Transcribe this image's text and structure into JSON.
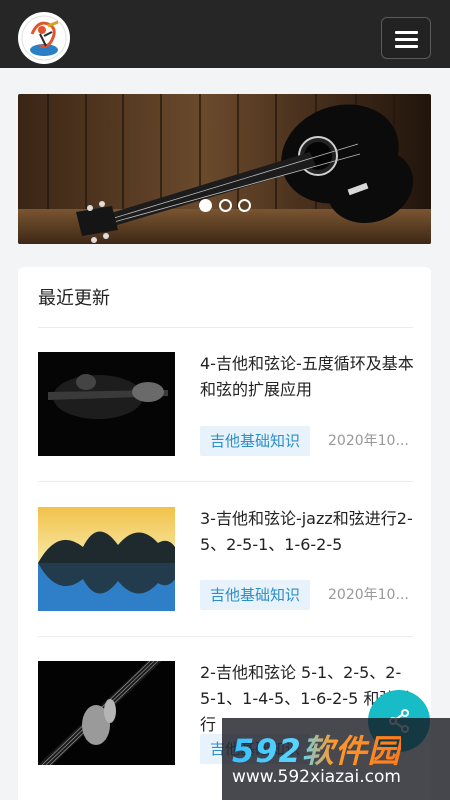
{
  "header": {
    "logo_icon": "guitar-logo-icon",
    "menu_icon": "hamburger-menu-icon"
  },
  "banner": {
    "slide_count": 3,
    "active_slide": 1
  },
  "section": {
    "title": "最近更新"
  },
  "articles": [
    {
      "title": "4-吉他和弦论-五度循环及基本和弦的扩展应用",
      "tag": "吉他基础知识",
      "date": "2020年10..."
    },
    {
      "title": "3-吉他和弦论-jazz和弦进行2-5、2-5-1、1-6-2-5",
      "tag": "吉他基础知识",
      "date": "2020年10..."
    },
    {
      "title": "2-吉他和弦论 5-1、2-5、2-5-1、1-4-5、1-6-2-5 和弦进行",
      "tag": "吉他基础知识",
      "date": ""
    }
  ],
  "fab": {
    "icon": "share-icon"
  },
  "watermark": {
    "brand": "592软件园",
    "url": "www.592xiazai.com"
  },
  "colors": {
    "topbar": "#262626",
    "accent": "#17bcc6",
    "tag_bg": "#e7f2fa",
    "tag_text": "#2c8ec9"
  }
}
